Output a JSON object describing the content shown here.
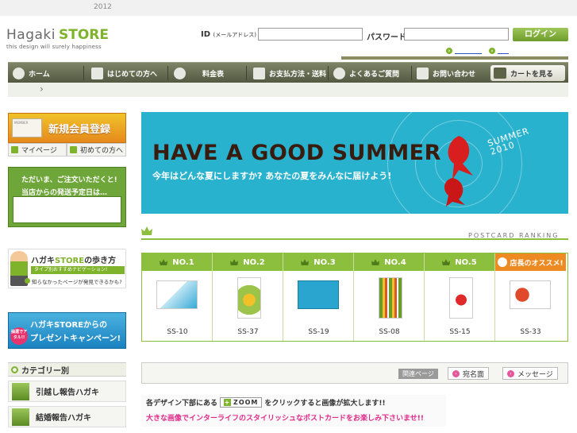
{
  "top": {
    "year": "2012"
  },
  "logo": {
    "brand_a": "Hagaki",
    "brand_b": "STORE",
    "tagline": "this design will surely happiness"
  },
  "login": {
    "id_label": "ID",
    "id_hint": "(メールアドレス)",
    "id_value": "",
    "pw_label": "パスワード :",
    "pw_value": "",
    "button": "ログイン",
    "link1": "",
    "link2": ""
  },
  "nav": {
    "items": [
      "ホーム",
      "はじめての方へ",
      "料金表",
      "お支払方法・送料",
      "よくあるご質問",
      "お問い合わせ"
    ],
    "cart": "カートを見る"
  },
  "breadcrumb": {
    "arrow": "›"
  },
  "sidebar": {
    "member_register": "新規会員登録",
    "member_card": "MEMBER",
    "mypage": "マイページ",
    "first_time": "初めての方へ",
    "ship_line1": "ただいま、ご注文いただくと!",
    "ship_line2": "当店からの発送予定日は…",
    "guide_title_a": "ハガキ",
    "guide_title_b": "STORE",
    "guide_title_c": "の歩き方",
    "guide_sub": "タイプ別おすすめナビゲーション!",
    "guide_note": "知らなかったページが発見できるかも?",
    "campaign_line1": "ハガキSTOREからの",
    "campaign_line2": "プレゼントキャンペーン!",
    "campaign_badge": "抽選でアタル!!",
    "category_head": "カテゴリー別",
    "categories": [
      "引越し報告ハガキ",
      "結婚報告ハガキ"
    ]
  },
  "banner": {
    "title": "HAVE A GOOD SUMMER",
    "subtitle": "今年はどんな夏にしますか? あなたの夏をみんなに届けよう!",
    "corner_a": "SUMMER",
    "corner_b": "2010"
  },
  "ranking": {
    "title": "POSTCARD RANKING",
    "columns": [
      {
        "label": "NO.1",
        "code": "SS-10"
      },
      {
        "label": "NO.2",
        "code": "SS-37"
      },
      {
        "label": "NO.3",
        "code": "SS-19"
      },
      {
        "label": "NO.4",
        "code": "SS-08"
      },
      {
        "label": "NO.5",
        "code": "SS-15"
      },
      {
        "label": "店長のオススメ!",
        "code": "SS-33"
      }
    ]
  },
  "related": {
    "tag": "関連ページ",
    "btn1": "宛名面",
    "btn2": "メッセージ"
  },
  "note": {
    "line1_a": "各デザイン下部にある",
    "zoom": "ZOOM",
    "line1_b": "をクリックすると画像が拡大します!!",
    "line2": "大きな画像でインターライフのスタイリッシュなポストカードをお楽しみ下さいませ!!"
  },
  "colors": {
    "accent": "#7fb32b",
    "nav": "#5f6650",
    "banner": "#29b2ce",
    "pick": "#ee8a22",
    "pink": "#e02a8a"
  }
}
